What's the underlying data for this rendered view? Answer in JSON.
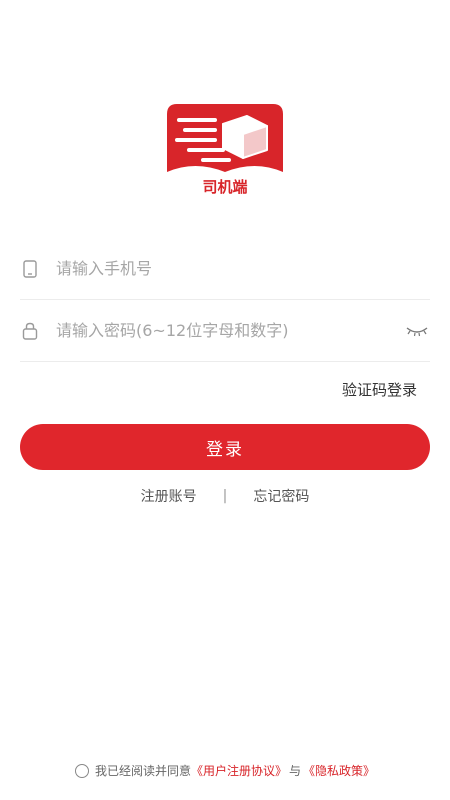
{
  "logo": {
    "label": "司机端",
    "brand_color": "#d8252a"
  },
  "form": {
    "phone": {
      "placeholder": "请输入手机号",
      "value": "",
      "icon": "phone-icon"
    },
    "password": {
      "placeholder": "请输入密码(6~12位字母和数字)",
      "value": "",
      "icon": "lock-icon",
      "toggle_icon": "eye-closed-icon"
    }
  },
  "sms_login_label": "验证码登录",
  "login_button": {
    "label": "登录",
    "color": "#e0262c"
  },
  "links": {
    "register": "注册账号",
    "separator": "|",
    "forgot": "忘记密码"
  },
  "agreement": {
    "prefix": "我已经阅读并同意",
    "user_agreement": "《用户注册协议》",
    "conjunction": "与",
    "privacy_policy": "《隐私政策》",
    "checked": false
  }
}
